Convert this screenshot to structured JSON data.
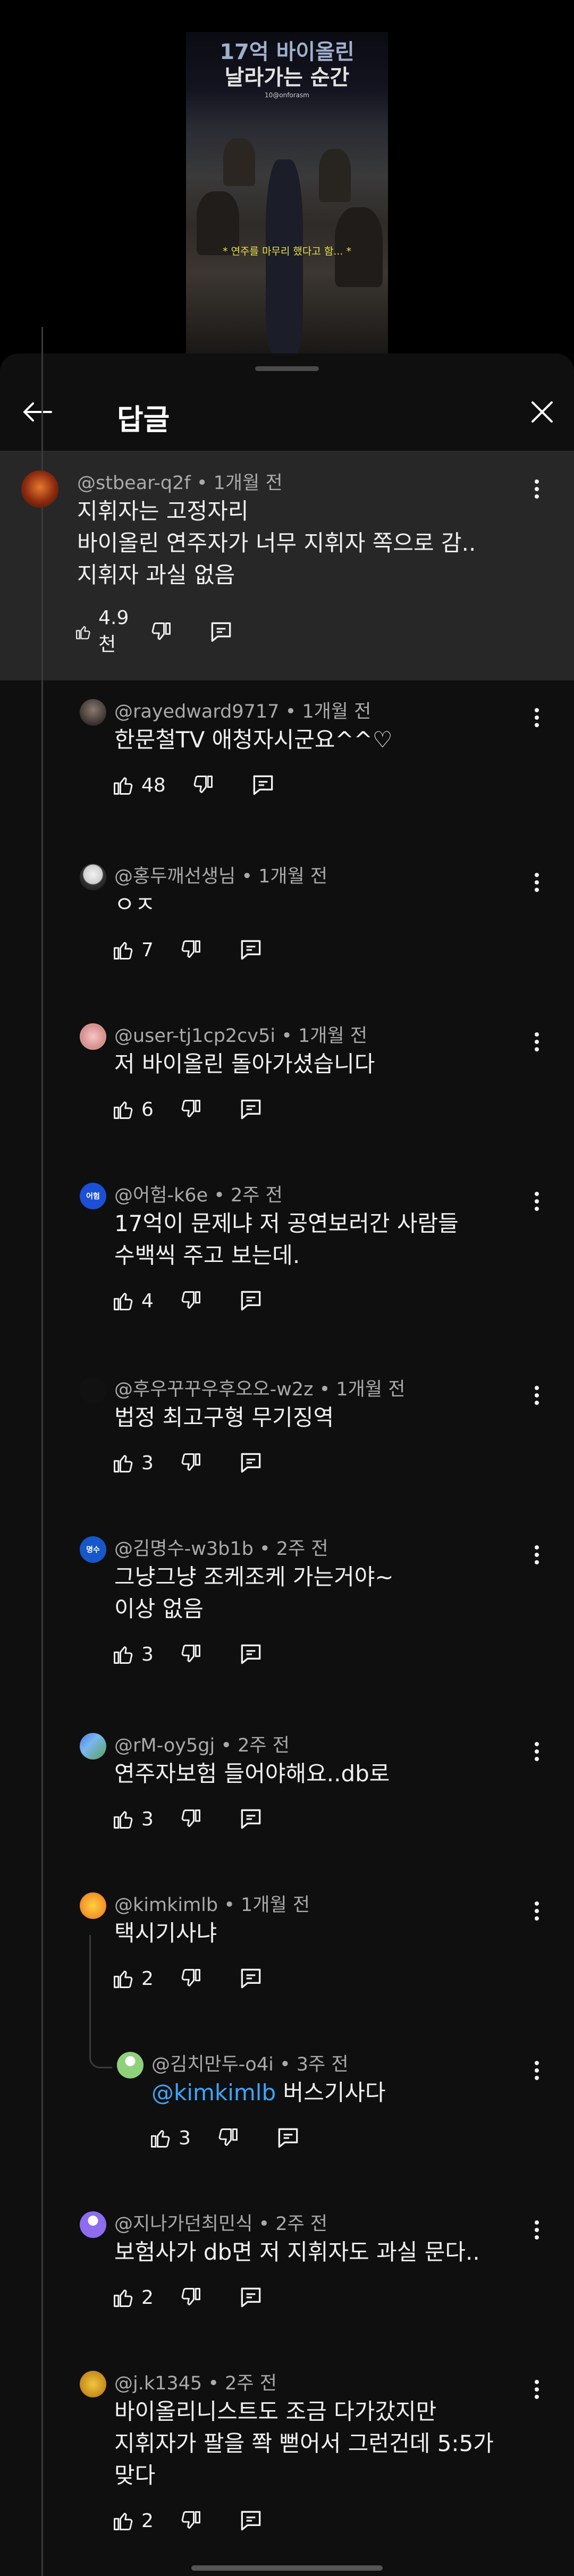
{
  "video": {
    "title_line1": "17억 바이올린",
    "title_line2": "날라가는 순간",
    "handle": "10@onforasm",
    "caption": "* 연주를 마무리 했다고 함... *"
  },
  "header": {
    "title": "답글"
  },
  "comments": [
    {
      "author": "@stbear-q2f",
      "time": "1개월 전",
      "lines": [
        "지휘자는 고정자리",
        "바이올린 연주자가 너무 지휘자 쪽으로 감..",
        "지휘자 과실 없음"
      ],
      "likes": "4.9천"
    },
    {
      "author": "@rayedward9717",
      "time": "1개월 전",
      "lines": [
        "한문철TV 애청자시군요^^♡"
      ],
      "likes": "48"
    },
    {
      "author": "@홍두깨선생님",
      "time": "1개월 전",
      "lines": [
        "ㅇㅈ"
      ],
      "likes": "7"
    },
    {
      "author": "@user-tj1cp2cv5i",
      "time": "1개월 전",
      "lines": [
        "저 바이올린 돌아가셨습니다"
      ],
      "likes": "6"
    },
    {
      "author": "@어험-k6e",
      "time": "2주 전",
      "lines": [
        "17억이 문제냐 저 공연보러간 사람들",
        "수백씩 주고 보는데."
      ],
      "likes": "4"
    },
    {
      "author": "@후우꾸꾸우후오오-w2z",
      "time": "1개월 전",
      "lines": [
        "법정 최고구형 무기징역"
      ],
      "likes": "3"
    },
    {
      "author": "@김명수-w3b1b",
      "time": "2주 전",
      "lines": [
        "그냥그냥 조케조케 가는거야~",
        "이상 없음"
      ],
      "likes": "3"
    },
    {
      "author": "@rM-oy5gj",
      "time": "2주 전",
      "lines": [
        "연주자보험 들어야해요..db로"
      ],
      "likes": "3"
    },
    {
      "author": "@kimkimlb",
      "time": "1개월 전",
      "lines": [
        "택시기사냐"
      ],
      "likes": "2"
    },
    {
      "author": "@김치만두-o4i",
      "time": "3주 전",
      "mention": "@kimkimlb",
      "lines": [
        " 버스기사다"
      ],
      "likes": "3"
    },
    {
      "author": "@지나가던최민식",
      "time": "2주 전",
      "lines": [
        "보험사가 db면 저 지휘자도 과실 문다.."
      ],
      "likes": "2"
    },
    {
      "author": "@j.k1345",
      "time": "2주 전",
      "lines": [
        "바이올리니스트도 조금 다가갔지만",
        "지휘자가 팔을 쫙 뻗어서 그런건데  5:5가",
        "맞다"
      ],
      "likes": "2"
    }
  ],
  "avatar_labels": {
    "c4": "어험",
    "c6": "명수"
  },
  "colors": {
    "background": "#0f0f0f",
    "highlight": "#272727",
    "mention": "#3ea6ff",
    "meta": "#aaaaaa"
  }
}
